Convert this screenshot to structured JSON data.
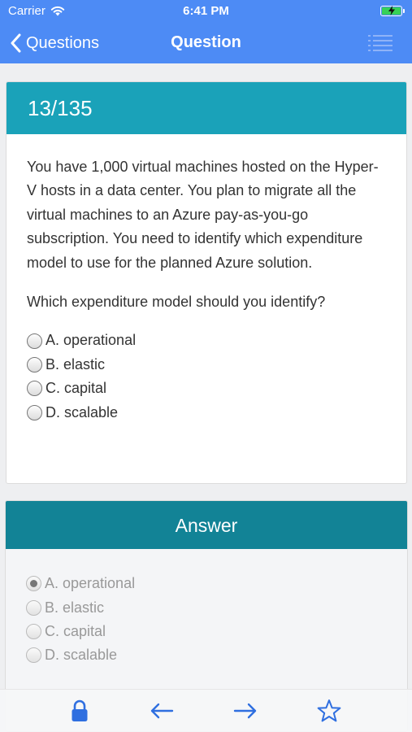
{
  "status_bar": {
    "carrier": "Carrier",
    "time": "6:41 PM"
  },
  "nav": {
    "back_label": "Questions",
    "title": "Question"
  },
  "question": {
    "counter": "13/135",
    "text": "You have 1,000 virtual machines hosted on the Hyper-V hosts in a data center. You plan to migrate all the virtual machines to an Azure pay-as-you-go subscription. You need to identify which expenditure model to use for the planned Azure solution.",
    "prompt": "Which expenditure model should you identify?",
    "options": [
      "A. operational",
      "B. elastic",
      "C. capital",
      "D. scalable"
    ]
  },
  "answer": {
    "title": "Answer",
    "options": [
      "A. operational",
      "B. elastic",
      "C. capital",
      "D. scalable"
    ],
    "selected_index": 0
  },
  "toolbar": {
    "icons": [
      "lock-icon",
      "arrow-left-icon",
      "arrow-right-icon",
      "star-icon"
    ]
  },
  "colors": {
    "nav": "#4d8bf5",
    "question_header": "#1aa2b9",
    "answer_header": "#128396",
    "toolbar_icon": "#2f6fe0"
  }
}
